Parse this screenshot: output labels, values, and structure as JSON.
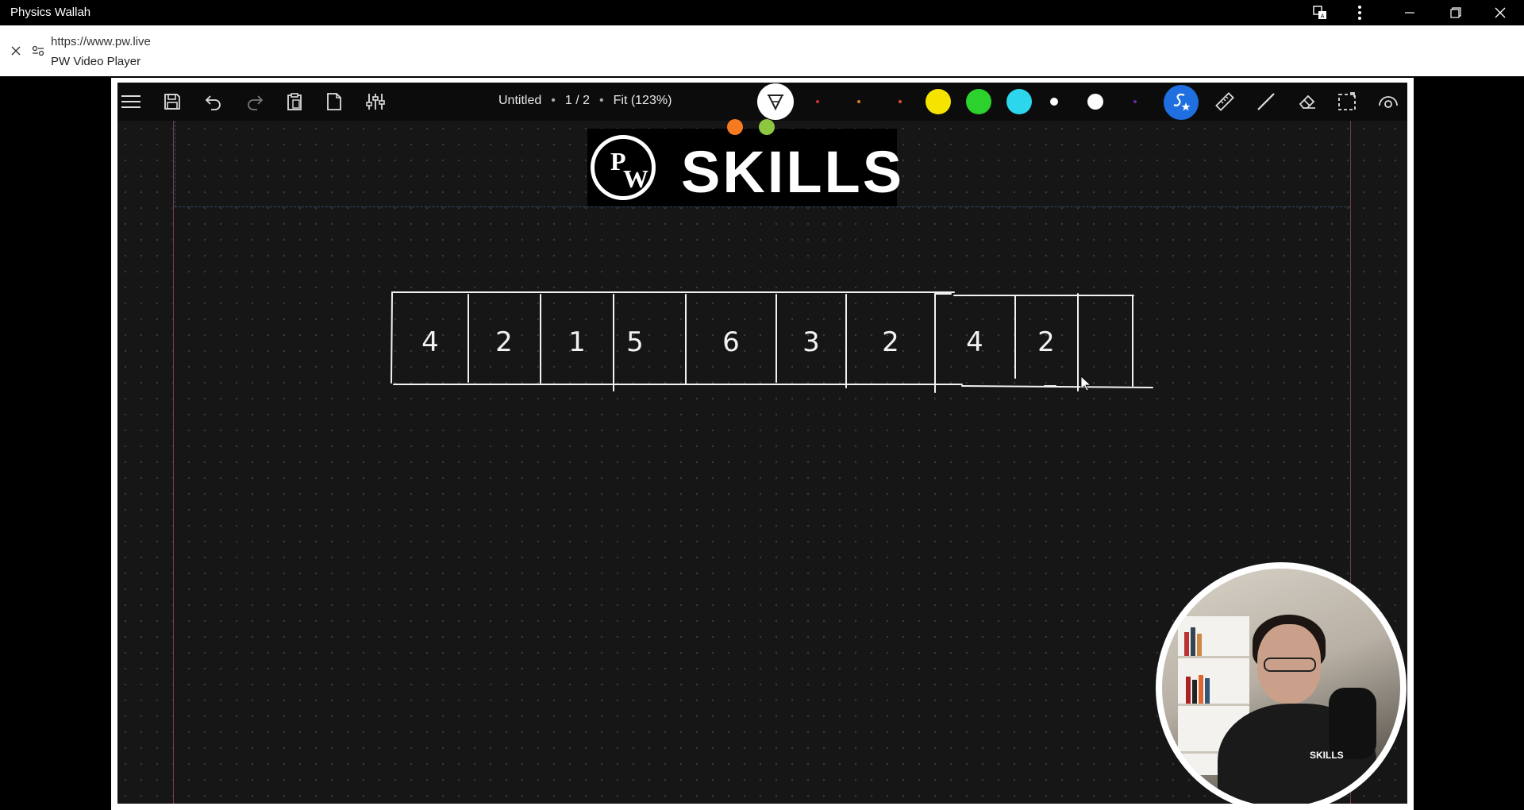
{
  "window": {
    "title": "Physics Wallah",
    "icons": [
      "translate-icon",
      "more-icon",
      "minimize-icon",
      "restore-icon",
      "close-icon"
    ]
  },
  "addressbar": {
    "url": "https://www.pw.live",
    "page_title": "PW Video Player"
  },
  "whiteboard": {
    "document_title": "Untitled",
    "page_indicator": "1 / 2",
    "zoom": "Fit (123%)",
    "colors": {
      "yellow": "#f5e400",
      "green": "#2dd12d",
      "cyan": "#2cd6ec",
      "white": "#ffffff",
      "red_dot": "#d23030",
      "orange_dot": "#e07a20",
      "purple_dot": "#6a2aa0",
      "active_tool": "#1f6fe0"
    }
  },
  "logo": {
    "monogram_top": "P",
    "monogram_bottom": "W",
    "wordmark": "SKILLS",
    "dot_colors": [
      "#f47b20",
      "#8dc63f"
    ]
  },
  "array_cells": [
    "4",
    "2",
    "1",
    "5",
    "6",
    "3",
    "2",
    "4",
    "2",
    ""
  ],
  "webcam": {
    "shirt_text": "SKILLS"
  }
}
